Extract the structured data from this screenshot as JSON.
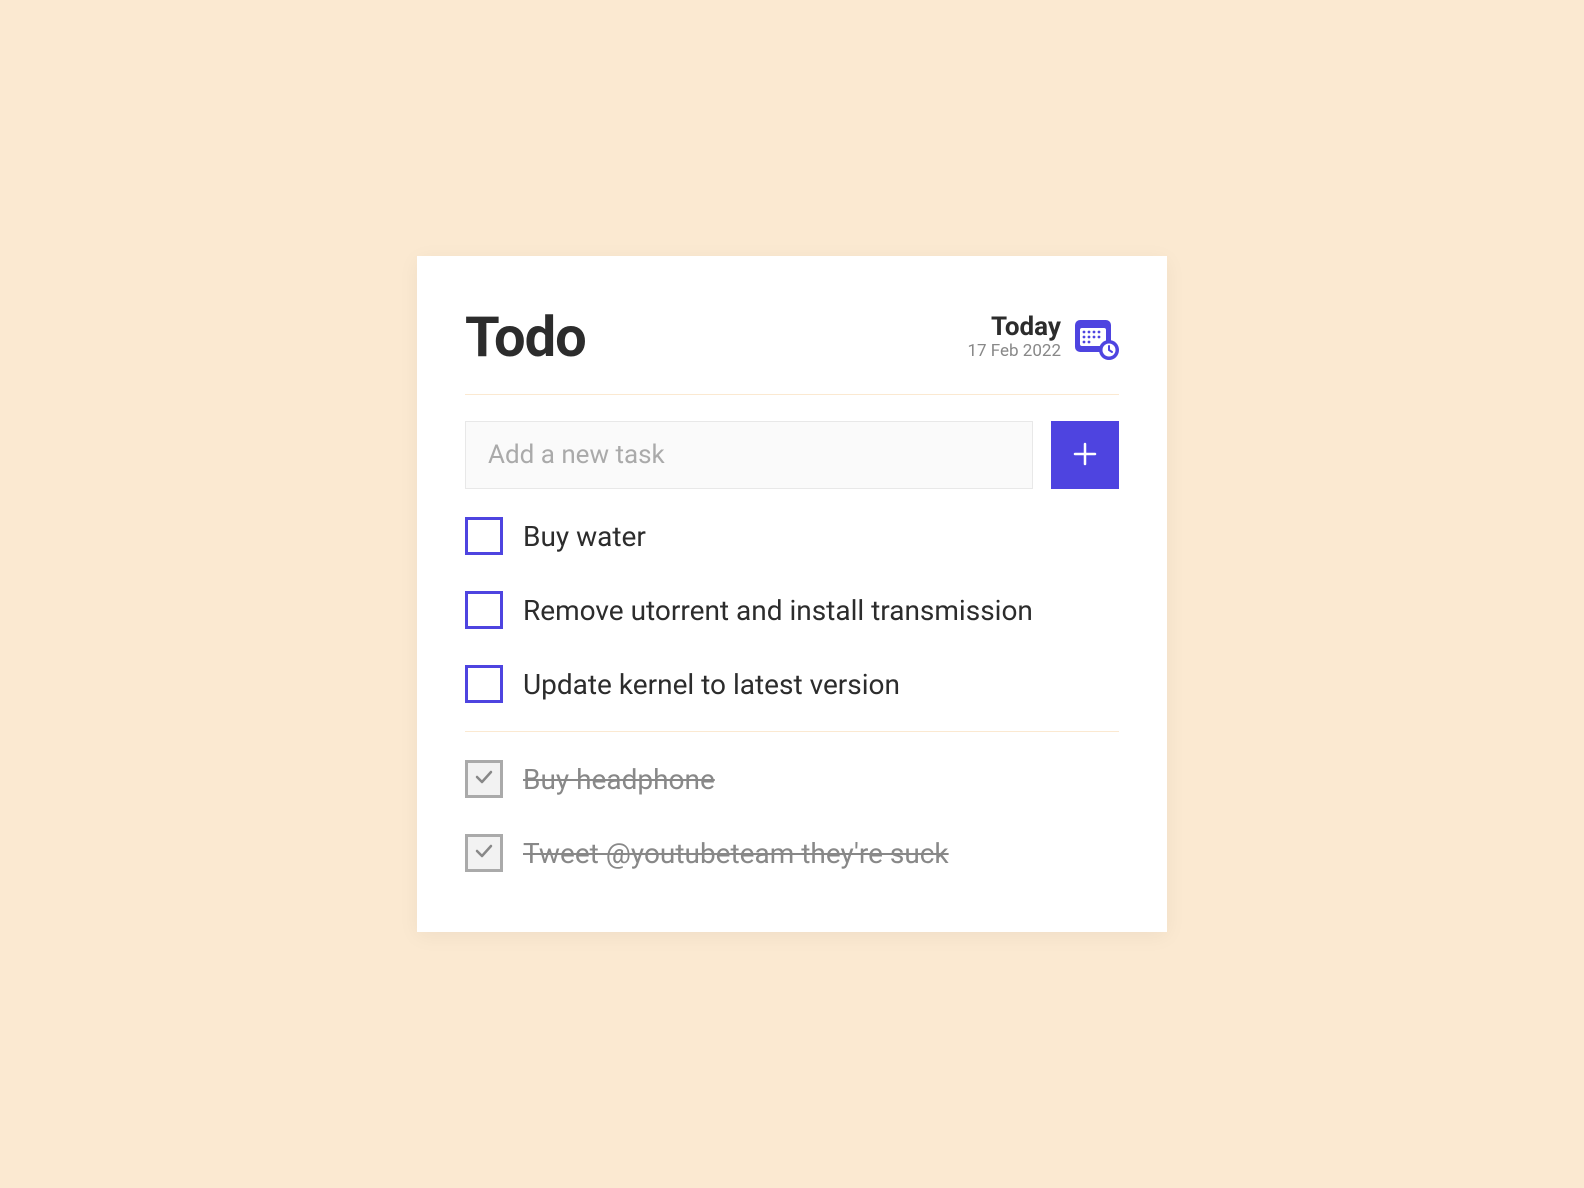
{
  "header": {
    "title": "Todo",
    "date_label": "Today",
    "date_value": "17 Feb 2022"
  },
  "input": {
    "placeholder": "Add a new task",
    "value": ""
  },
  "colors": {
    "accent": "#4E44E0",
    "background": "#FBE9D1"
  },
  "tasks": {
    "active": [
      {
        "label": "Buy water",
        "checked": false
      },
      {
        "label": "Remove utorrent and install transmission",
        "checked": false
      },
      {
        "label": "Update kernel to latest version",
        "checked": false
      }
    ],
    "completed": [
      {
        "label": "Buy headphone",
        "checked": true
      },
      {
        "label": "Tweet @youtubeteam they're suck",
        "checked": true
      }
    ]
  }
}
